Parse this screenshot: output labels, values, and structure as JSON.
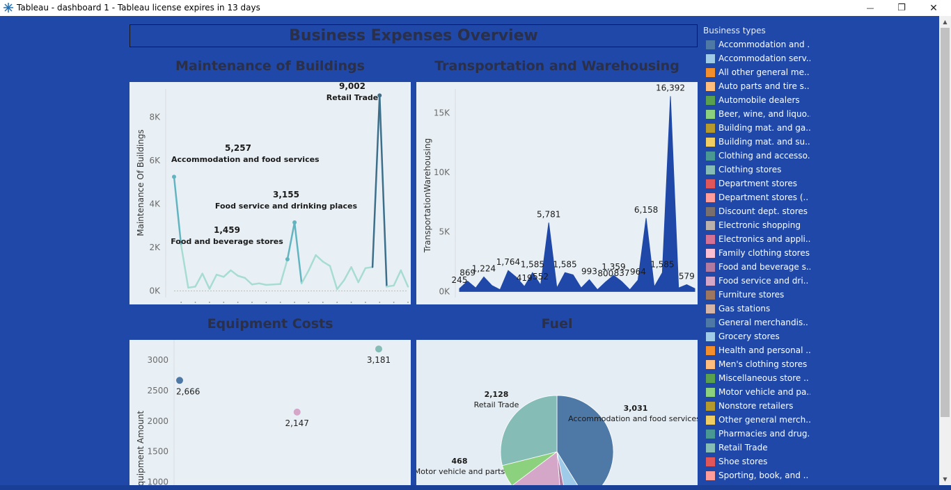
{
  "window": {
    "title": "Tableau - dashboard 1 - Tableau license expires in 13 days",
    "minimize_glyph": "—",
    "maximize_glyph": "❐",
    "close_glyph": "✕"
  },
  "dashboard": {
    "title": "Business Expenses Overview"
  },
  "sheets": {
    "maintenance_title": "Maintenance of Buildings",
    "transport_title": "Transportation and Warehousing",
    "equipment_title": "Equipment Costs",
    "fuel_title": "Fuel"
  },
  "legend": {
    "title": "Business types",
    "items": [
      {
        "label": "Accommodation and ..",
        "color": "#4e79a7"
      },
      {
        "label": "Accommodation serv..",
        "color": "#a0cbe8"
      },
      {
        "label": "All other general me..",
        "color": "#f28e2b"
      },
      {
        "label": "Auto parts and tire s..",
        "color": "#ffbe7d"
      },
      {
        "label": "Automobile dealers",
        "color": "#59a14f"
      },
      {
        "label": "Beer, wine, and liquo..",
        "color": "#8cd17d"
      },
      {
        "label": "Building mat. and ga..",
        "color": "#b6992d"
      },
      {
        "label": "Building mat. and su..",
        "color": "#f1ce63"
      },
      {
        "label": "Clothing and accesso..",
        "color": "#499894"
      },
      {
        "label": "Clothing stores",
        "color": "#86bcb6"
      },
      {
        "label": "Department stores",
        "color": "#e15759"
      },
      {
        "label": "Department stores (..",
        "color": "#ff9d9a"
      },
      {
        "label": "Discount dept. stores",
        "color": "#79706e"
      },
      {
        "label": "Electronic shopping",
        "color": "#bab0ac"
      },
      {
        "label": "Electronics and appli..",
        "color": "#d37295"
      },
      {
        "label": "Family clothing stores",
        "color": "#fabfd2"
      },
      {
        "label": "Food and beverage s..",
        "color": "#b07aa1"
      },
      {
        "label": "Food service and dri..",
        "color": "#d4a6c8"
      },
      {
        "label": "Furniture stores",
        "color": "#9d7660"
      },
      {
        "label": "Gas stations",
        "color": "#d7b5a6"
      },
      {
        "label": "General merchandis..",
        "color": "#4e79a7"
      },
      {
        "label": "Grocery stores",
        "color": "#a0cbe8"
      },
      {
        "label": "Health and personal ..",
        "color": "#f28e2b"
      },
      {
        "label": "Men's clothing stores",
        "color": "#ffbe7d"
      },
      {
        "label": "Miscellaneous store ..",
        "color": "#59a14f"
      },
      {
        "label": "Motor vehicle and pa..",
        "color": "#8cd17d"
      },
      {
        "label": "Nonstore retailers",
        "color": "#b6992d"
      },
      {
        "label": "Other general merch..",
        "color": "#f1ce63"
      },
      {
        "label": "Pharmacies and drug..",
        "color": "#499894"
      },
      {
        "label": "Retail Trade",
        "color": "#86bcb6"
      },
      {
        "label": "Shoe stores",
        "color": "#e15759"
      },
      {
        "label": "Sporting, book, and ..",
        "color": "#ff9d9a"
      },
      {
        "label": "",
        "color": "#79706e"
      }
    ]
  },
  "chart_data": [
    {
      "id": "maintenance",
      "type": "line",
      "ylabel": "Maintenance Of Buildings",
      "ylim": [
        -300,
        9300
      ],
      "yticks": [
        0,
        2000,
        4000,
        6000,
        8000
      ],
      "ytick_labels": [
        "0K",
        "2K",
        "4K",
        "6K",
        "8K"
      ],
      "values": [
        5257,
        2100,
        150,
        200,
        800,
        100,
        750,
        650,
        950,
        700,
        600,
        300,
        350,
        280,
        300,
        320,
        1459,
        3155,
        350,
        950,
        1650,
        1350,
        1150,
        80,
        500,
        1100,
        400,
        1050,
        1100,
        9002,
        200,
        250,
        950,
        200
      ],
      "annotations": [
        {
          "index": 0,
          "value": "5,257",
          "label": "Accommodation and food services"
        },
        {
          "index": 16,
          "value": "1,459",
          "label": "Food and beverage stores"
        },
        {
          "index": 17,
          "value": "3,155",
          "label": "Food service and drinking places"
        },
        {
          "index": 29,
          "value": "9,002",
          "label": "Retail Trade"
        }
      ]
    },
    {
      "id": "transport",
      "type": "area",
      "ylabel": "TransportationWarehousing",
      "ylim": [
        -500,
        17000
      ],
      "yticks": [
        0,
        5000,
        10000,
        15000
      ],
      "ytick_labels": [
        "0K",
        "5K",
        "10K",
        "15K"
      ],
      "values": [
        245,
        869,
        300,
        1224,
        500,
        150,
        1764,
        1200,
        419,
        1585,
        552,
        5781,
        300,
        1585,
        1400,
        300,
        993,
        150,
        800,
        1359,
        837,
        150,
        964,
        6158,
        400,
        1585,
        16392,
        300,
        579,
        250
      ],
      "labels": [
        "245",
        "869",
        "",
        "1,224",
        "",
        "",
        "1,764",
        "",
        "419",
        "1,585",
        "552",
        "5,781",
        "",
        "1,585",
        "",
        "",
        "993",
        "",
        "800",
        "1,359",
        "837",
        "",
        "964",
        "6,158",
        "",
        "1,585",
        "16,392",
        "",
        "579",
        ""
      ],
      "color": "#1f48a8"
    },
    {
      "id": "equipment",
      "type": "scatter",
      "ylabel": "Equipment Amount",
      "ylim": [
        950,
        3330
      ],
      "yticks": [
        1000,
        1500,
        2000,
        2500,
        3000
      ],
      "ytick_labels": [
        "1000",
        "1500",
        "2000",
        "2500",
        "3000"
      ],
      "points": [
        {
          "x": 0,
          "y": 2666,
          "label": "2,666",
          "color": "#4e79a7"
        },
        {
          "x": 0.59,
          "y": 2147,
          "label": "2,147",
          "color": "#d4a6c8"
        },
        {
          "x": 1,
          "y": 3181,
          "label": "3,181",
          "color": "#86bcb6"
        }
      ]
    },
    {
      "id": "fuel",
      "type": "pie",
      "slices": [
        {
          "name": "Accommodation and food services",
          "value": 3031,
          "color": "#4e79a7",
          "value_label": "3,031"
        },
        {
          "name": "",
          "value": 420,
          "color": "#a0cbe8",
          "value_label": ""
        },
        {
          "name": "",
          "value": 130,
          "color": "#b07aa1",
          "value_label": ""
        },
        {
          "name": "",
          "value": 1180,
          "color": "#d4a6c8",
          "value_label": ""
        },
        {
          "name": "Motor vehicle and parts",
          "value": 468,
          "color": "#8cd17d",
          "value_label": "468"
        },
        {
          "name": "Retail Trade",
          "value": 2128,
          "color": "#86bcb6",
          "value_label": "2,128"
        }
      ]
    }
  ]
}
